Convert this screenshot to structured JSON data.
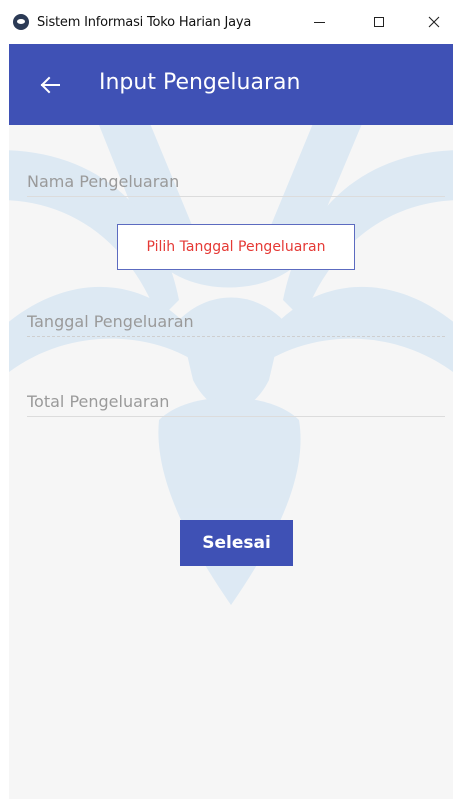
{
  "window": {
    "title": "Sistem Informasi Toko Harian Jaya",
    "icon": "app-icon",
    "controls": [
      "minimize-icon",
      "maximize-icon",
      "close-icon"
    ]
  },
  "appbar": {
    "title": "Input Pengeluaran",
    "back_icon": "arrow-left-icon",
    "color": "#3f51b5"
  },
  "form": {
    "nama_placeholder": "Nama Pengeluaran",
    "date_button_label": "Pilih Tanggal Pengeluaran",
    "tanggal_placeholder": "Tanggal Pengeluaran",
    "total_placeholder": "Total Pengeluaran",
    "submit_label": "Selesai"
  },
  "colors": {
    "primary": "#3f51b5",
    "date_button_text": "#e53935",
    "background": "#f6f6f6"
  }
}
